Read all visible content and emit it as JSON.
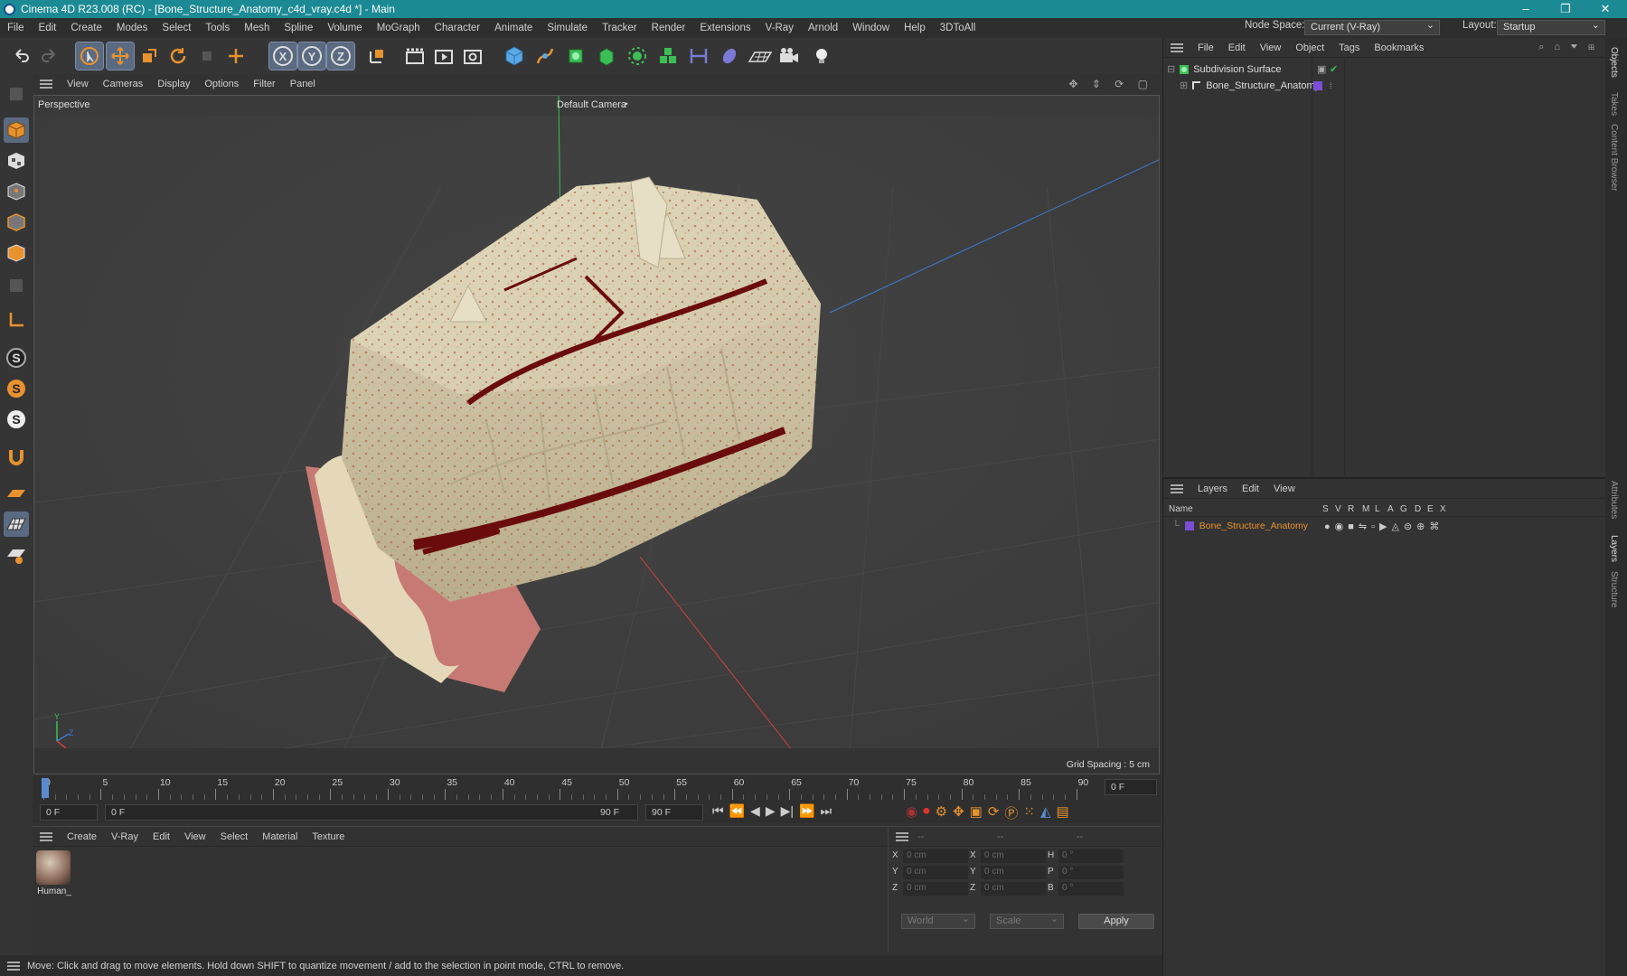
{
  "titlebar": {
    "title": "Cinema 4D R23.008 (RC) - [Bone_Structure_Anatomy_c4d_vray.c4d *] - Main",
    "minimize": "–",
    "maximize": "❐",
    "close": "✕"
  },
  "menubar": {
    "items": [
      "File",
      "Edit",
      "Create",
      "Modes",
      "Select",
      "Tools",
      "Mesh",
      "Spline",
      "Volume",
      "MoGraph",
      "Character",
      "Animate",
      "Simulate",
      "Tracker",
      "Render",
      "Extensions",
      "V-Ray",
      "Arnold",
      "Window",
      "Help",
      "3DToAll"
    ],
    "node_space_label": "Node Space:",
    "node_space_value": "Current (V-Ray)",
    "layout_label": "Layout:",
    "layout_value": "Startup"
  },
  "viewport_menu": [
    "View",
    "Cameras",
    "Display",
    "Options",
    "Filter",
    "Panel"
  ],
  "viewport": {
    "name": "Perspective",
    "camera": "Default Camera",
    "camera_mark": ":•",
    "grid_spacing": "Grid Spacing : 5 cm",
    "axis_y": "Y",
    "axis_z": "Z",
    "axis_x": "X"
  },
  "timeline": {
    "ticks": [
      "0",
      "5",
      "10",
      "15",
      "20",
      "25",
      "30",
      "35",
      "40",
      "45",
      "50",
      "55",
      "60",
      "65",
      "70",
      "75",
      "80",
      "85",
      "90"
    ],
    "end_frame": "0 F",
    "current_frame": "0 F",
    "range_start": "0 F",
    "range_end": "90 F",
    "max_frame": "90 F"
  },
  "material_panel": {
    "menu": [
      "Create",
      "V-Ray",
      "Edit",
      "View",
      "Select",
      "Material",
      "Texture"
    ],
    "material_name": "Human_"
  },
  "coord_panel": {
    "headers": [
      "--",
      "--",
      "--"
    ],
    "rows": [
      {
        "a": "X",
        "av": "0 cm",
        "b": "X",
        "bv": "0 cm",
        "c": "H",
        "cv": "0 °"
      },
      {
        "a": "Y",
        "av": "0 cm",
        "b": "Y",
        "bv": "0 cm",
        "c": "P",
        "cv": "0 °"
      },
      {
        "a": "Z",
        "av": "0 cm",
        "b": "Z",
        "bv": "0 cm",
        "c": "B",
        "cv": "0 °"
      }
    ],
    "coord_system": "World",
    "mode": "Scale",
    "apply_label": "Apply"
  },
  "object_panel": {
    "menu": [
      "File",
      "Edit",
      "View",
      "Object",
      "Tags",
      "Bookmarks"
    ],
    "objects": [
      {
        "name": "Subdivision Surface"
      },
      {
        "name": "Bone_Structure_Anatomy"
      }
    ]
  },
  "layer_panel": {
    "menu": [
      "Layers",
      "Edit",
      "View"
    ],
    "columns": [
      "Name",
      "S",
      "V",
      "R",
      "M",
      "L",
      "A",
      "G",
      "D",
      "E",
      "X"
    ],
    "layers": [
      {
        "name": "Bone_Structure_Anatomy",
        "color": "#7a4fd6"
      }
    ]
  },
  "side_tabs": [
    "Objects",
    "Takes",
    "Content Browser",
    "Attributes",
    "Layers",
    "Structure"
  ],
  "status_bar": {
    "message": "Move: Click and drag to move elements. Hold down SHIFT to quantize movement / add to the selection in point mode, CTRL to remove."
  },
  "colors": {
    "accent": "#e8922e",
    "title_bar": "#1b8a95",
    "layer_color": "#7a4fd6",
    "axis_green": "#3bbf55",
    "axis_red": "#d04040",
    "axis_blue": "#3a7bd5"
  }
}
